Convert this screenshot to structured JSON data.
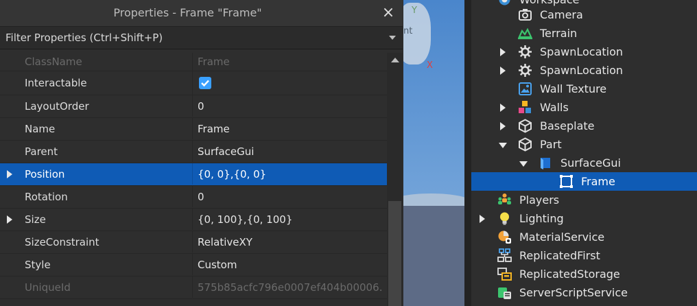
{
  "properties_panel": {
    "title": "Properties - Frame \"Frame\"",
    "close_glyph": "×",
    "filter_placeholder": "Filter Properties (Ctrl+Shift+P)",
    "rows": [
      {
        "name": "ClassName",
        "value": "Frame"
      },
      {
        "name": "Interactable",
        "value": ""
      },
      {
        "name": "LayoutOrder",
        "value": "0"
      },
      {
        "name": "Name",
        "value": "Frame"
      },
      {
        "name": "Parent",
        "value": "SurfaceGui"
      },
      {
        "name": "Position",
        "value": "{0, 0},{0, 0}"
      },
      {
        "name": "Rotation",
        "value": "0"
      },
      {
        "name": "Size",
        "value": "{0, 100},{0, 100}"
      },
      {
        "name": "SizeConstraint",
        "value": "RelativeXY"
      },
      {
        "name": "Style",
        "value": "Custom"
      },
      {
        "name": "UniqueId",
        "value": "575b85acfc796e0007ef404b00006…"
      }
    ],
    "interactable_checked": true
  },
  "viewport": {
    "axis_x": "X",
    "axis_y": "Y",
    "axis_z": "nt"
  },
  "explorer": {
    "items": [
      {
        "label": "Workspace",
        "icon": "workspace-icon"
      },
      {
        "label": "Camera",
        "icon": "camera-icon"
      },
      {
        "label": "Terrain",
        "icon": "terrain-icon"
      },
      {
        "label": "SpawnLocation",
        "icon": "spawn-location-icon"
      },
      {
        "label": "SpawnLocation",
        "icon": "spawn-location-icon"
      },
      {
        "label": "Wall Texture",
        "icon": "image-icon"
      },
      {
        "label": "Walls",
        "icon": "model-icon"
      },
      {
        "label": "Baseplate",
        "icon": "part-icon"
      },
      {
        "label": "Part",
        "icon": "part-icon"
      },
      {
        "label": "SurfaceGui",
        "icon": "surface-gui-icon"
      },
      {
        "label": "Frame",
        "icon": "frame-icon"
      },
      {
        "label": "Players",
        "icon": "players-icon"
      },
      {
        "label": "Lighting",
        "icon": "lighting-icon"
      },
      {
        "label": "MaterialService",
        "icon": "material-service-icon"
      },
      {
        "label": "ReplicatedFirst",
        "icon": "replicated-first-icon"
      },
      {
        "label": "ReplicatedStorage",
        "icon": "replicated-storage-icon"
      },
      {
        "label": "ServerScriptService",
        "icon": "server-script-service-icon"
      }
    ]
  },
  "colors": {
    "panel_bg": "#2e2e2e",
    "selection": "#0f5bb5",
    "checkbox": "#3aa0ff"
  }
}
